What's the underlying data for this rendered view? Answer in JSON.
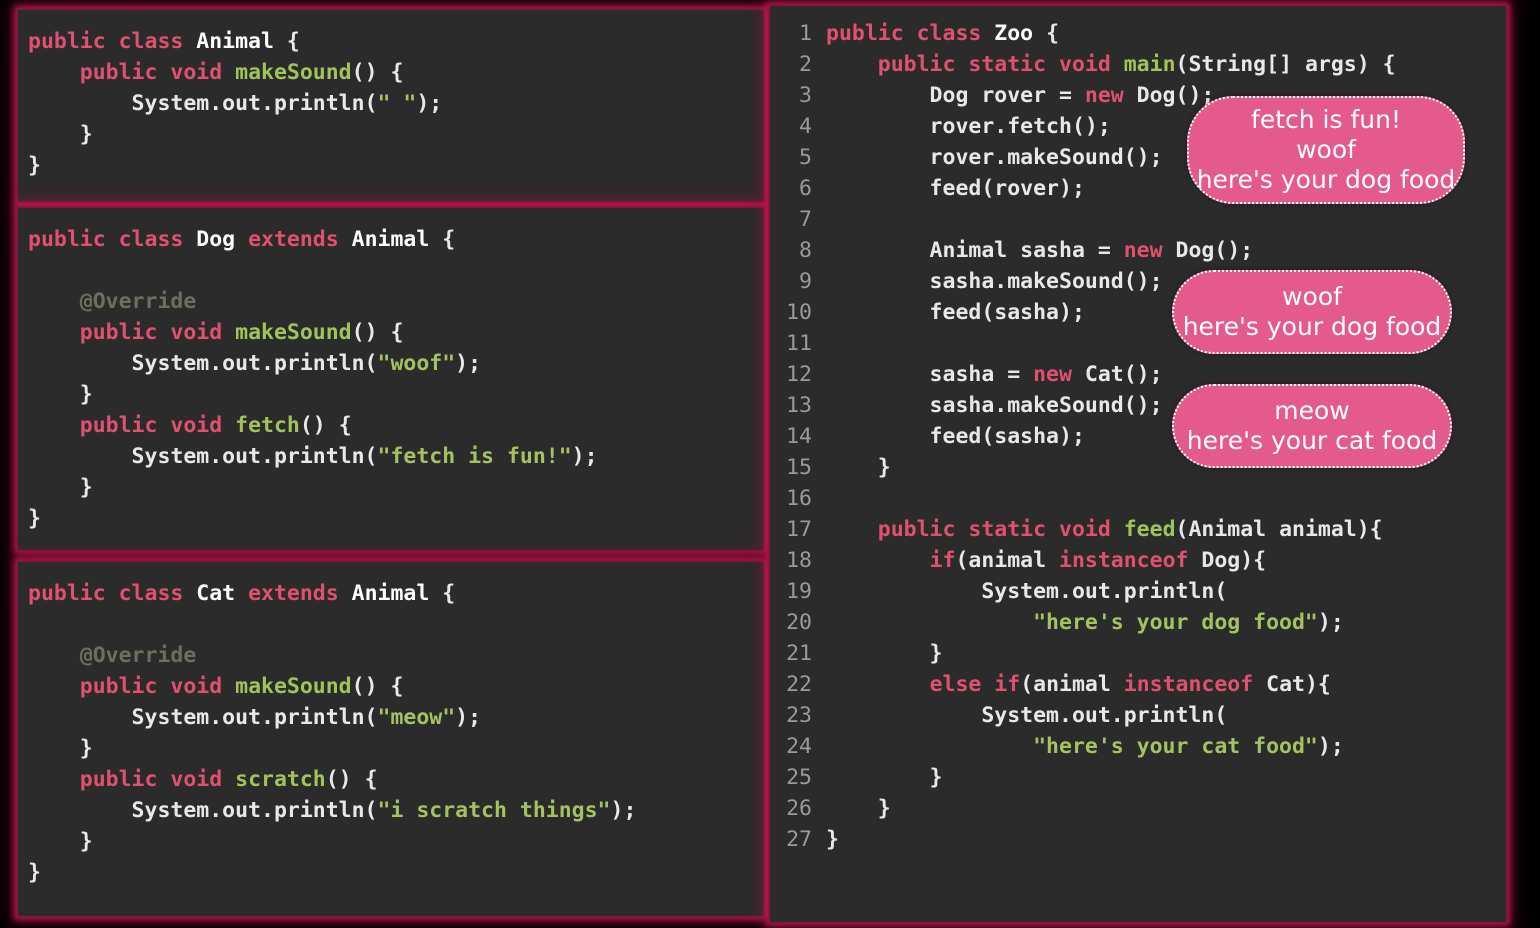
{
  "panels": [
    {
      "id": "animal",
      "class_name": "Animal",
      "lines": [
        [
          {
            "t": "public ",
            "c": "kw"
          },
          {
            "t": "class ",
            "c": "kw"
          },
          {
            "t": "Animal",
            "c": "cls"
          },
          {
            "t": " {",
            "c": "pun"
          }
        ],
        [
          {
            "t": "    ",
            "c": "pln"
          },
          {
            "t": "public ",
            "c": "kw"
          },
          {
            "t": "void ",
            "c": "kw"
          },
          {
            "t": "makeSound",
            "c": "mth"
          },
          {
            "t": "() {",
            "c": "pun"
          }
        ],
        [
          {
            "t": "        System.out.println(",
            "c": "pln"
          },
          {
            "t": "\" \"",
            "c": "str"
          },
          {
            "t": ");",
            "c": "pun"
          }
        ],
        [
          {
            "t": "    }",
            "c": "pun"
          }
        ],
        [
          {
            "t": "}",
            "c": "pun"
          }
        ]
      ]
    },
    {
      "id": "dog",
      "class_name": "Dog",
      "lines": [
        [
          {
            "t": "public ",
            "c": "kw"
          },
          {
            "t": "class ",
            "c": "kw"
          },
          {
            "t": "Dog ",
            "c": "cls"
          },
          {
            "t": "extends ",
            "c": "kw"
          },
          {
            "t": "Animal",
            "c": "cls"
          },
          {
            "t": " {",
            "c": "pun"
          }
        ],
        [
          {
            "t": " ",
            "c": "pln"
          }
        ],
        [
          {
            "t": "    ",
            "c": "pln"
          },
          {
            "t": "@Override",
            "c": "ann"
          }
        ],
        [
          {
            "t": "    ",
            "c": "pln"
          },
          {
            "t": "public ",
            "c": "kw"
          },
          {
            "t": "void ",
            "c": "kw"
          },
          {
            "t": "makeSound",
            "c": "mth"
          },
          {
            "t": "() {",
            "c": "pun"
          }
        ],
        [
          {
            "t": "        System.out.println(",
            "c": "pln"
          },
          {
            "t": "\"woof\"",
            "c": "str"
          },
          {
            "t": ");",
            "c": "pun"
          }
        ],
        [
          {
            "t": "    }",
            "c": "pun"
          }
        ],
        [
          {
            "t": "    ",
            "c": "pln"
          },
          {
            "t": "public ",
            "c": "kw"
          },
          {
            "t": "void ",
            "c": "kw"
          },
          {
            "t": "fetch",
            "c": "mth"
          },
          {
            "t": "() {",
            "c": "pun"
          }
        ],
        [
          {
            "t": "        System.out.println(",
            "c": "pln"
          },
          {
            "t": "\"fetch is fun!\"",
            "c": "str"
          },
          {
            "t": ");",
            "c": "pun"
          }
        ],
        [
          {
            "t": "    }",
            "c": "pun"
          }
        ],
        [
          {
            "t": "}",
            "c": "pun"
          }
        ]
      ]
    },
    {
      "id": "cat",
      "class_name": "Cat",
      "lines": [
        [
          {
            "t": "public ",
            "c": "kw"
          },
          {
            "t": "class ",
            "c": "kw"
          },
          {
            "t": "Cat ",
            "c": "cls"
          },
          {
            "t": "extends ",
            "c": "kw"
          },
          {
            "t": "Animal",
            "c": "cls"
          },
          {
            "t": " {",
            "c": "pun"
          }
        ],
        [
          {
            "t": " ",
            "c": "pln"
          }
        ],
        [
          {
            "t": "    ",
            "c": "pln"
          },
          {
            "t": "@Override",
            "c": "ann"
          }
        ],
        [
          {
            "t": "    ",
            "c": "pln"
          },
          {
            "t": "public ",
            "c": "kw"
          },
          {
            "t": "void ",
            "c": "kw"
          },
          {
            "t": "makeSound",
            "c": "mth"
          },
          {
            "t": "() {",
            "c": "pun"
          }
        ],
        [
          {
            "t": "        System.out.println(",
            "c": "pln"
          },
          {
            "t": "\"meow\"",
            "c": "str"
          },
          {
            "t": ");",
            "c": "pun"
          }
        ],
        [
          {
            "t": "    }",
            "c": "pun"
          }
        ],
        [
          {
            "t": "    ",
            "c": "pln"
          },
          {
            "t": "public ",
            "c": "kw"
          },
          {
            "t": "void ",
            "c": "kw"
          },
          {
            "t": "scratch",
            "c": "mth"
          },
          {
            "t": "() {",
            "c": "pun"
          }
        ],
        [
          {
            "t": "        System.out.println(",
            "c": "pln"
          },
          {
            "t": "\"i scratch things\"",
            "c": "str"
          },
          {
            "t": ");",
            "c": "pun"
          }
        ],
        [
          {
            "t": "    }",
            "c": "pun"
          }
        ],
        [
          {
            "t": "}",
            "c": "pun"
          }
        ]
      ]
    }
  ],
  "zoo": {
    "class_name": "Zoo",
    "line_numbers": [
      1,
      2,
      3,
      4,
      5,
      6,
      7,
      8,
      9,
      10,
      11,
      12,
      13,
      14,
      15,
      16,
      17,
      18,
      19,
      20,
      21,
      22,
      23,
      24,
      25,
      26,
      27
    ],
    "lines": [
      [
        {
          "t": "public ",
          "c": "kw"
        },
        {
          "t": "class ",
          "c": "kw"
        },
        {
          "t": "Zoo",
          "c": "cls"
        },
        {
          "t": " {",
          "c": "pun"
        }
      ],
      [
        {
          "t": "    ",
          "c": "pln"
        },
        {
          "t": "public ",
          "c": "kw"
        },
        {
          "t": "static ",
          "c": "kw"
        },
        {
          "t": "void ",
          "c": "kw"
        },
        {
          "t": "main",
          "c": "mth"
        },
        {
          "t": "(String[] args) {",
          "c": "pun"
        }
      ],
      [
        {
          "t": "        Dog rover = ",
          "c": "pln"
        },
        {
          "t": "new ",
          "c": "kw"
        },
        {
          "t": "Dog();",
          "c": "pln"
        }
      ],
      [
        {
          "t": "        rover.fetch();",
          "c": "pln"
        }
      ],
      [
        {
          "t": "        rover.makeSound();",
          "c": "pln"
        }
      ],
      [
        {
          "t": "        feed(rover);",
          "c": "pln"
        }
      ],
      [
        {
          "t": " ",
          "c": "pln"
        }
      ],
      [
        {
          "t": "        Animal sasha = ",
          "c": "pln"
        },
        {
          "t": "new ",
          "c": "kw"
        },
        {
          "t": "Dog();",
          "c": "pln"
        }
      ],
      [
        {
          "t": "        sasha.makeSound();",
          "c": "pln"
        }
      ],
      [
        {
          "t": "        feed(sasha);",
          "c": "pln"
        }
      ],
      [
        {
          "t": " ",
          "c": "pln"
        }
      ],
      [
        {
          "t": "        sasha = ",
          "c": "pln"
        },
        {
          "t": "new ",
          "c": "kw"
        },
        {
          "t": "Cat();",
          "c": "pln"
        }
      ],
      [
        {
          "t": "        sasha.makeSound();",
          "c": "pln"
        }
      ],
      [
        {
          "t": "        feed(sasha);",
          "c": "pln"
        }
      ],
      [
        {
          "t": "    }",
          "c": "pun"
        }
      ],
      [
        {
          "t": " ",
          "c": "pln"
        }
      ],
      [
        {
          "t": "    ",
          "c": "pln"
        },
        {
          "t": "public ",
          "c": "kw"
        },
        {
          "t": "static ",
          "c": "kw"
        },
        {
          "t": "void ",
          "c": "kw"
        },
        {
          "t": "feed",
          "c": "mth"
        },
        {
          "t": "(Animal animal){",
          "c": "pun"
        }
      ],
      [
        {
          "t": "        ",
          "c": "pln"
        },
        {
          "t": "if",
          "c": "kw"
        },
        {
          "t": "(animal ",
          "c": "pln"
        },
        {
          "t": "instanceof ",
          "c": "kw"
        },
        {
          "t": "Dog){",
          "c": "pln"
        }
      ],
      [
        {
          "t": "            System.out.println(",
          "c": "pln"
        }
      ],
      [
        {
          "t": "                ",
          "c": "pln"
        },
        {
          "t": "\"here's your dog food\"",
          "c": "str"
        },
        {
          "t": ");",
          "c": "pun"
        }
      ],
      [
        {
          "t": "        }",
          "c": "pun"
        }
      ],
      [
        {
          "t": "        ",
          "c": "pln"
        },
        {
          "t": "else ",
          "c": "kw"
        },
        {
          "t": "if",
          "c": "kw"
        },
        {
          "t": "(animal ",
          "c": "pln"
        },
        {
          "t": "instanceof ",
          "c": "kw"
        },
        {
          "t": "Cat){",
          "c": "pln"
        }
      ],
      [
        {
          "t": "            System.out.println(",
          "c": "pln"
        }
      ],
      [
        {
          "t": "                ",
          "c": "pln"
        },
        {
          "t": "\"here's your cat food\"",
          "c": "str"
        },
        {
          "t": ");",
          "c": "pun"
        }
      ],
      [
        {
          "t": "        }",
          "c": "pun"
        }
      ],
      [
        {
          "t": "    }",
          "c": "pun"
        }
      ],
      [
        {
          "t": "}",
          "c": "pun"
        }
      ]
    ]
  },
  "callouts": [
    {
      "id": "callout-1",
      "lines": [
        "fetch is fun!",
        "woof",
        "here's your dog food"
      ]
    },
    {
      "id": "callout-2",
      "lines": [
        "woof",
        "here's your dog food"
      ]
    },
    {
      "id": "callout-3",
      "lines": [
        "meow",
        "here's your cat food"
      ]
    }
  ],
  "colors": {
    "background": "#000000",
    "panel_background": "#2b2b2b",
    "panel_border": "#8c1240",
    "panel_glow": "#c81955",
    "keyword": "#e0506f",
    "type_name": "#ffffff",
    "method_name": "#9fc45a",
    "string_literal": "#a5c261",
    "plain_text": "#e8e8e8",
    "annotation": "#6e6e5e",
    "gutter_text": "#9a9a9a",
    "callout_fill": "#e55a8c",
    "callout_border": "#ffffff",
    "callout_text": "#ffffff"
  }
}
